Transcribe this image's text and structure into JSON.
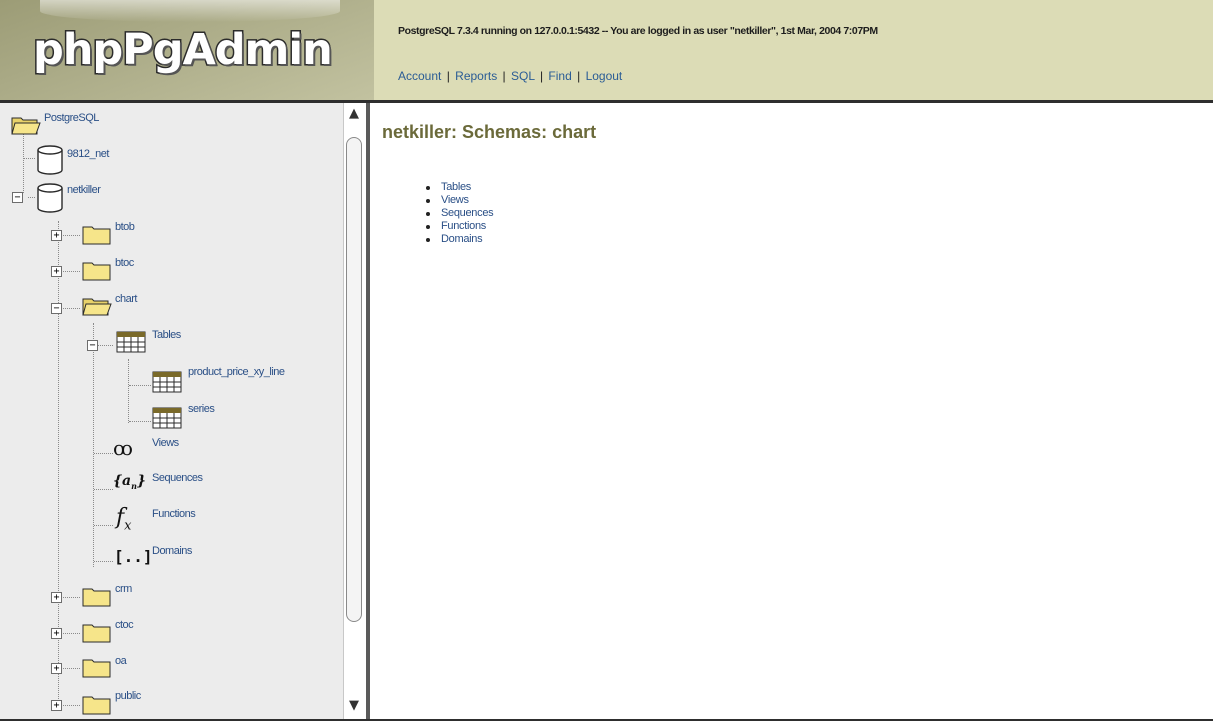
{
  "header": {
    "logo_text": "phpPgAdmin",
    "server_info": "PostgreSQL 7.3.4 running on 127.0.0.1:5432 -- You are logged in as user \"netkiller\", 1st Mar, 2004 7:07PM",
    "nav": {
      "account": "Account",
      "reports": "Reports",
      "sql": "SQL",
      "find": "Find",
      "logout": "Logout",
      "separator": "|"
    }
  },
  "tree": {
    "root": "PostgreSQL",
    "databases": [
      {
        "label": "9812_net",
        "expanded": false
      },
      {
        "label": "netkiller",
        "expanded": true
      }
    ],
    "schemas": [
      "btob",
      "btoc",
      "chart",
      "crm",
      "ctoc",
      "oa",
      "public"
    ],
    "chart_children": {
      "tables": "Tables",
      "table_items": [
        "product_price_xy_line",
        "series"
      ],
      "views": "Views",
      "sequences": "Sequences",
      "functions": "Functions",
      "domains": "Domains"
    },
    "icons": {
      "views_glyph": "ꝏ",
      "sequences_glyph": "{a",
      "sequences_sub": "n",
      "functions_glyph": "f",
      "functions_sub": "x",
      "domains_glyph": "[..]"
    },
    "toggle_plus": "+",
    "toggle_minus": "−"
  },
  "main": {
    "heading": "netkiller: Schemas: chart",
    "items": [
      "Tables",
      "Views",
      "Sequences",
      "Functions",
      "Domains"
    ]
  },
  "scrollbar": {
    "up": "▲",
    "down": "▼"
  },
  "colors": {
    "header_bg": "#dcdcb6",
    "logo_bg": "#a9a985",
    "link": "#2a4f86",
    "heading": "#6b6a3a",
    "tree_bg": "#ececec"
  }
}
